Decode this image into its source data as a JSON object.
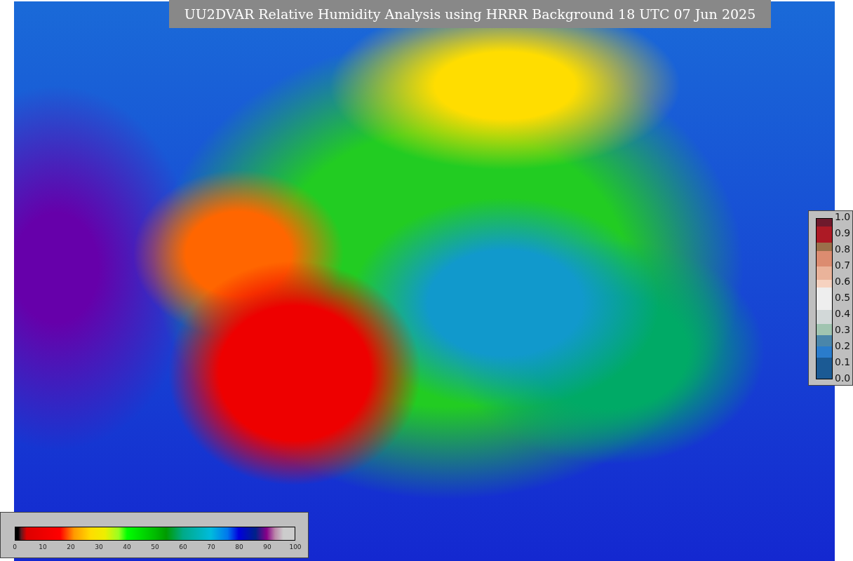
{
  "title": "UU2DVAR Relative Humidity Analysis using HRRR Background 18 UTC 07 Jun 2025",
  "side_legend": {
    "ticks": [
      "1.0",
      "0.9",
      "0.8",
      "0.7",
      "0.6",
      "0.5",
      "0.4",
      "0.3",
      "0.2",
      "0.1",
      "0.0"
    ]
  },
  "colorbar": {
    "ticks": [
      "0",
      "10",
      "20",
      "30",
      "40",
      "50",
      "60",
      "70",
      "80",
      "90",
      "100"
    ]
  }
}
